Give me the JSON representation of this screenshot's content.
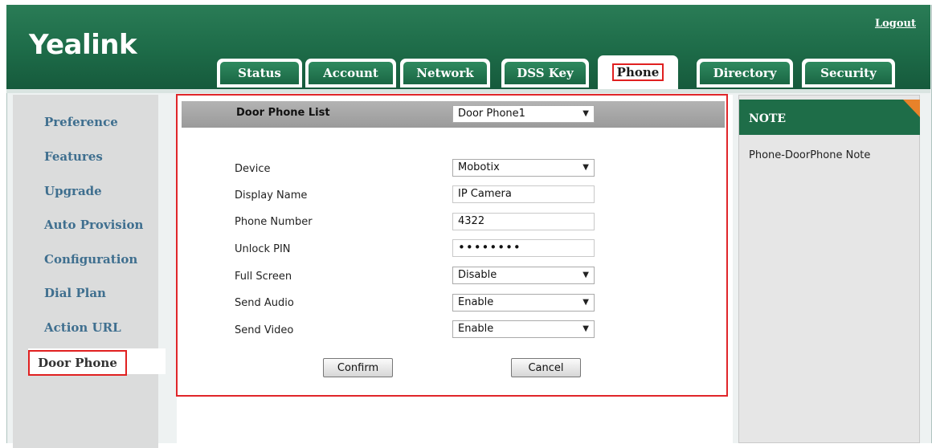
{
  "header": {
    "logo": "Yealink",
    "logout": "Logout",
    "tabs": [
      {
        "label": "Status"
      },
      {
        "label": "Account"
      },
      {
        "label": "Network"
      },
      {
        "label": "DSS Key"
      },
      {
        "label": "Phone",
        "active": true
      },
      {
        "label": "Directory"
      },
      {
        "label": "Security"
      }
    ]
  },
  "sidebar": {
    "items": [
      {
        "label": "Preference"
      },
      {
        "label": "Features"
      },
      {
        "label": "Upgrade"
      },
      {
        "label": "Auto Provision"
      },
      {
        "label": "Configuration"
      },
      {
        "label": "Dial Plan"
      },
      {
        "label": "Action URL"
      },
      {
        "label": "Door Phone",
        "active": true
      }
    ]
  },
  "form": {
    "list_label": "Door Phone List",
    "list_value": "Door Phone1",
    "fields": {
      "device": {
        "label": "Device",
        "value": "Mobotix"
      },
      "display_name": {
        "label": "Display Name",
        "value": "IP Camera"
      },
      "phone_number": {
        "label": "Phone Number",
        "value": "4322"
      },
      "unlock_pin": {
        "label": "Unlock PIN",
        "value": "••••••••"
      },
      "full_screen": {
        "label": "Full Screen",
        "value": "Disable"
      },
      "send_audio": {
        "label": "Send Audio",
        "value": "Enable"
      },
      "send_video": {
        "label": "Send Video",
        "value": "Enable"
      }
    },
    "confirm_label": "Confirm",
    "cancel_label": "Cancel"
  },
  "note": {
    "title": "NOTE",
    "text": "Phone-DoorPhone Note"
  },
  "colors": {
    "brand_green": "#1d6b48",
    "highlight_red": "#e0262a",
    "note_corner": "#e8822a",
    "nav_link": "#3f6f8f"
  },
  "icons": {
    "dropdown": "chevron-down-icon"
  }
}
